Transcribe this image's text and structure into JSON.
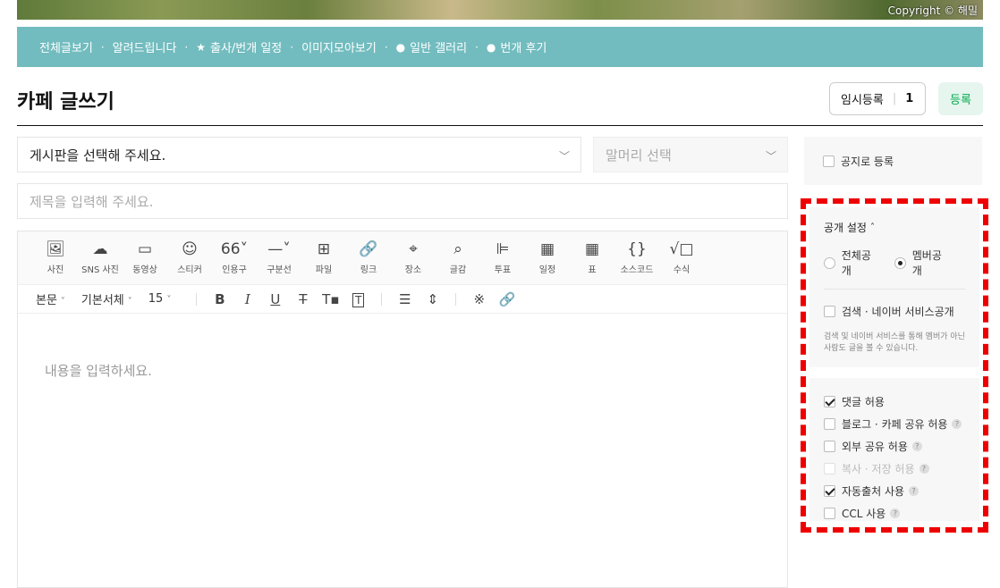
{
  "banner": {
    "copyright": "Copyright © 해밀"
  },
  "nav": {
    "items": [
      {
        "label": "전체글보기",
        "glyph": ""
      },
      {
        "label": "알려드립니다",
        "glyph": ""
      },
      {
        "label": "출사/번개 일정",
        "glyph": "★"
      },
      {
        "label": "이미지모아보기",
        "glyph": ""
      },
      {
        "label": "일반 갤러리",
        "glyph": "●"
      },
      {
        "label": "번개 후기",
        "glyph": "●"
      }
    ],
    "separator": "·"
  },
  "page": {
    "title": "카페 글쓰기"
  },
  "header": {
    "temp_save_label": "임시등록",
    "temp_save_count": "1",
    "register_label": "등록"
  },
  "form": {
    "board_select": "게시판을 선택해 주세요.",
    "head_select": "말머리 선택",
    "subject_placeholder": "제목을 입력해 주세요.",
    "body_placeholder": "내용을 입력하세요."
  },
  "toolbar": {
    "tools": [
      {
        "label": "사진",
        "icon": "image-icon",
        "glyph": "🖼"
      },
      {
        "label": "SNS 사진",
        "icon": "cloud-upload-icon",
        "glyph": "☁"
      },
      {
        "label": "동영상",
        "icon": "video-icon",
        "glyph": "▭"
      },
      {
        "label": "스티커",
        "icon": "smile-icon",
        "glyph": "☺"
      },
      {
        "label": "인용구",
        "icon": "quote-icon",
        "glyph": "66˅"
      },
      {
        "label": "구분선",
        "icon": "divider-icon",
        "glyph": "—˅"
      },
      {
        "label": "파일",
        "icon": "file-add-icon",
        "glyph": "⊞"
      },
      {
        "label": "링크",
        "icon": "link-icon",
        "glyph": "🔗"
      },
      {
        "label": "장소",
        "icon": "location-icon",
        "glyph": "⌖"
      },
      {
        "label": "글감",
        "icon": "search-doc-icon",
        "glyph": "⌕"
      },
      {
        "label": "투표",
        "icon": "vote-icon",
        "glyph": "⊫"
      },
      {
        "label": "일정",
        "icon": "calendar-icon",
        "glyph": "▦"
      },
      {
        "label": "표",
        "icon": "table-icon",
        "glyph": "▦"
      },
      {
        "label": "소스코드",
        "icon": "code-icon",
        "glyph": "{}"
      },
      {
        "label": "수식",
        "icon": "formula-icon",
        "glyph": "√□"
      }
    ],
    "paragraph_style": "본문",
    "font_family": "기본서체",
    "font_size": "15"
  },
  "sidebar": {
    "notice_label": "공지로 등록",
    "privacy_title": "공개 설정",
    "radio_all": "전체공개",
    "radio_member": "멤버공개",
    "search_label": "검색 · 네이버 서비스공개",
    "search_desc": "검색 및 네이버 서비스를 통해 멤버가 아닌 사람도 글을 볼 수 있습니다.",
    "options": [
      {
        "label": "댓글 허용",
        "checked": true,
        "help": false,
        "disabled": false
      },
      {
        "label": "블로그 · 카페 공유 허용",
        "checked": false,
        "help": true,
        "disabled": false
      },
      {
        "label": "외부 공유 허용",
        "checked": false,
        "help": true,
        "disabled": false
      },
      {
        "label": "복사 · 저장 허용",
        "checked": false,
        "help": true,
        "disabled": true
      },
      {
        "label": "자동출처 사용",
        "checked": true,
        "help": true,
        "disabled": false
      },
      {
        "label": "CCL 사용",
        "checked": false,
        "help": true,
        "disabled": false
      }
    ],
    "help_glyph": "?",
    "highlight_color": "#ee0000"
  }
}
